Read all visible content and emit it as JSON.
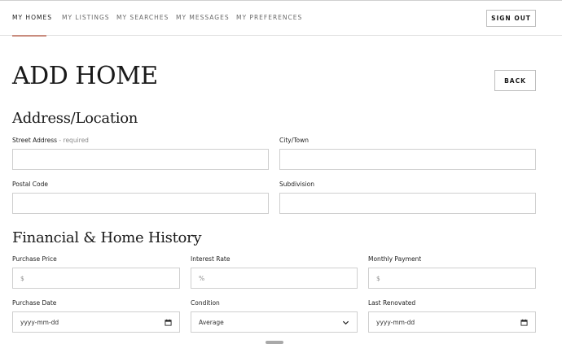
{
  "nav": {
    "items": [
      {
        "label": "MY HOMES"
      },
      {
        "label": "MY LISTINGS"
      },
      {
        "label": "MY SEARCHES"
      },
      {
        "label": "MY MESSAGES"
      },
      {
        "label": "MY PREFERENCES"
      }
    ],
    "sign_out_label": "SIGN OUT",
    "active_color": "#c98c7e"
  },
  "page": {
    "title": "ADD HOME",
    "back_label": "BACK"
  },
  "address_section": {
    "title": "Address/Location",
    "street_label": "Street Address",
    "street_hint": " - required",
    "city_label": "City/Town",
    "postal_label": "Postal Code",
    "subdivision_label": "Subdivision"
  },
  "financial_section": {
    "title": "Financial & Home History",
    "purchase_price_label": "Purchase Price",
    "purchase_price_placeholder": "$",
    "interest_rate_label": "Interest Rate",
    "interest_rate_placeholder": "%",
    "monthly_payment_label": "Monthly Payment",
    "monthly_payment_placeholder": "$",
    "purchase_date_label": "Purchase Date",
    "purchase_date_placeholder": "yyyy-mm-dd",
    "condition_label": "Condition",
    "condition_value": "Average",
    "last_renovated_label": "Last Renovated",
    "last_renovated_placeholder": "yyyy-mm-dd"
  }
}
